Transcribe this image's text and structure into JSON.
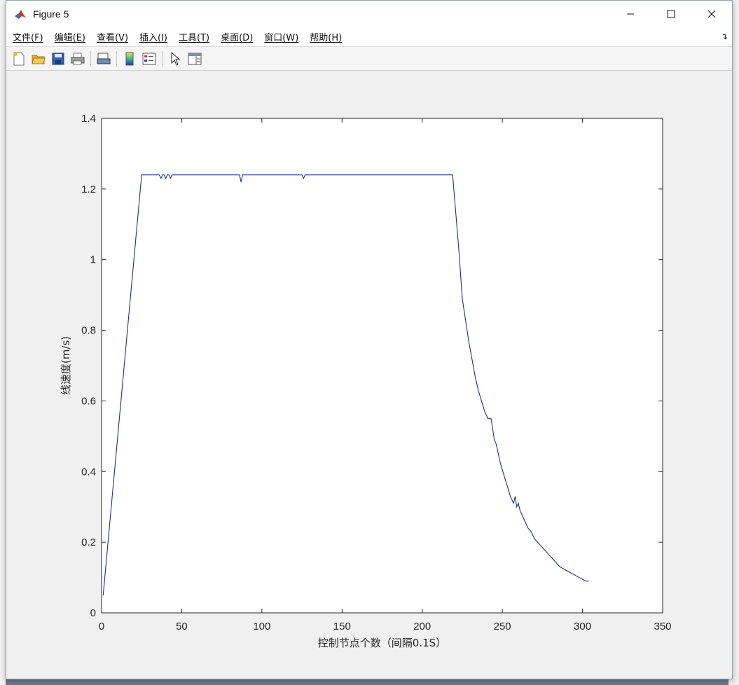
{
  "window": {
    "title": "Figure 5"
  },
  "menu": [
    {
      "label": "文件(F)"
    },
    {
      "label": "编辑(E)"
    },
    {
      "label": "查看(V)"
    },
    {
      "label": "插入(I)"
    },
    {
      "label": "工具(T)"
    },
    {
      "label": "桌面(D)"
    },
    {
      "label": "窗口(W)"
    },
    {
      "label": "帮助(H)"
    }
  ],
  "toolbar_icons": [
    "new-figure-icon",
    "open-file-icon",
    "save-icon",
    "print-icon",
    "print-preview-icon",
    "colorbar-icon",
    "legend-icon",
    "select-pointer-icon",
    "property-inspector-icon"
  ],
  "chart_data": {
    "type": "line",
    "xlabel": "控制节点个数（间隔0.1S）",
    "ylabel": "线速度(m/s)",
    "xlim": [
      0,
      350
    ],
    "ylim": [
      0,
      1.4
    ],
    "xticks": [
      0,
      50,
      100,
      150,
      200,
      250,
      300,
      350
    ],
    "yticks": [
      0,
      0.2,
      0.4,
      0.6,
      0.8,
      1,
      1.2,
      1.4
    ],
    "xtick_labels": [
      "0",
      "50",
      "100",
      "150",
      "200",
      "250",
      "300",
      "350"
    ],
    "ytick_labels": [
      "0",
      "0.2",
      "0.4",
      "0.6",
      "0.8",
      "1",
      "1.2",
      "1.4"
    ],
    "color": "#1f2f8a",
    "series": [
      {
        "x": [
          1,
          25,
          36,
          37,
          38,
          39,
          40,
          41,
          42,
          43,
          44,
          86,
          87,
          88,
          125,
          126,
          127,
          219,
          221,
          223,
          225,
          227,
          229,
          231,
          233,
          235,
          237,
          239,
          241,
          243,
          245,
          246,
          247,
          248,
          249,
          251,
          253,
          255,
          257,
          258,
          259,
          260,
          261,
          262,
          264,
          266,
          268,
          270,
          272,
          274,
          276,
          278,
          280,
          282,
          284,
          286,
          288,
          290,
          292,
          294,
          296,
          298,
          300,
          302,
          304
        ],
        "y": [
          0.05,
          1.24,
          1.24,
          1.23,
          1.24,
          1.24,
          1.23,
          1.24,
          1.24,
          1.23,
          1.24,
          1.24,
          1.22,
          1.24,
          1.24,
          1.23,
          1.24,
          1.24,
          1.13,
          1.02,
          0.89,
          0.83,
          0.77,
          0.72,
          0.67,
          0.63,
          0.6,
          0.57,
          0.55,
          0.55,
          0.49,
          0.48,
          0.46,
          0.44,
          0.42,
          0.39,
          0.36,
          0.33,
          0.31,
          0.33,
          0.3,
          0.31,
          0.29,
          0.28,
          0.26,
          0.24,
          0.23,
          0.21,
          0.2,
          0.19,
          0.18,
          0.17,
          0.16,
          0.15,
          0.14,
          0.13,
          0.125,
          0.12,
          0.115,
          0.11,
          0.105,
          0.1,
          0.095,
          0.09,
          0.09
        ]
      }
    ]
  }
}
